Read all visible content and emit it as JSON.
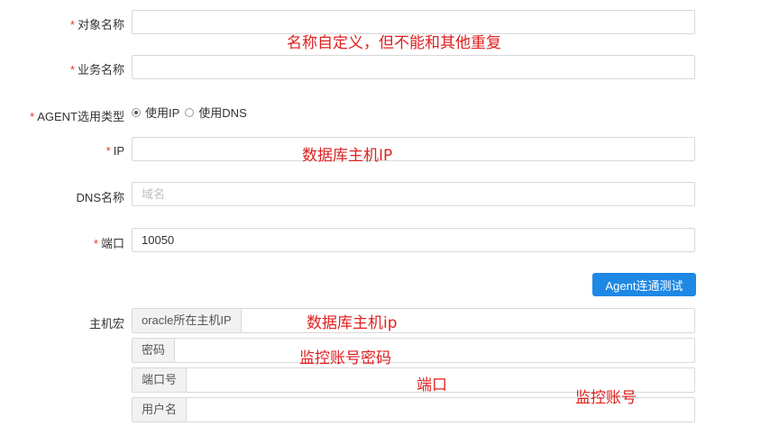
{
  "form": {
    "object_name": {
      "label": "对象名称",
      "required_mark": "*",
      "value": ""
    },
    "business_name": {
      "label": "业务名称",
      "required_mark": "*",
      "value": ""
    },
    "agent_type": {
      "label": "AGENT选用类型",
      "required_mark": "*",
      "options": [
        "使用IP",
        "使用DNS"
      ],
      "selected": "使用IP"
    },
    "ip": {
      "label": "IP",
      "required_mark": "*",
      "value": ""
    },
    "dns_name": {
      "label": "DNS名称",
      "placeholder": "域名",
      "value": ""
    },
    "port": {
      "label": "端口",
      "required_mark": "*",
      "value": "10050"
    },
    "test_button": "Agent连通测试",
    "host_macro": {
      "label": "主机宏",
      "rows": [
        {
          "key": "oracle所在主机IP",
          "value": ""
        },
        {
          "key": "密码",
          "value": ""
        },
        {
          "key": "端口号",
          "value": ""
        },
        {
          "key": "用户名",
          "value": ""
        }
      ]
    }
  },
  "annotations": {
    "name_note": "名称自定义，但不能和其他重复",
    "ip_note": "数据库主机IP",
    "macro_ip_note": "数据库主机ip",
    "macro_password_note": "监控账号密码",
    "macro_port_note": "端口",
    "macro_user_note": "监控账号"
  },
  "colors": {
    "required": "#e53935",
    "annotation": "#e02020",
    "primary_button": "#1e88e5"
  }
}
